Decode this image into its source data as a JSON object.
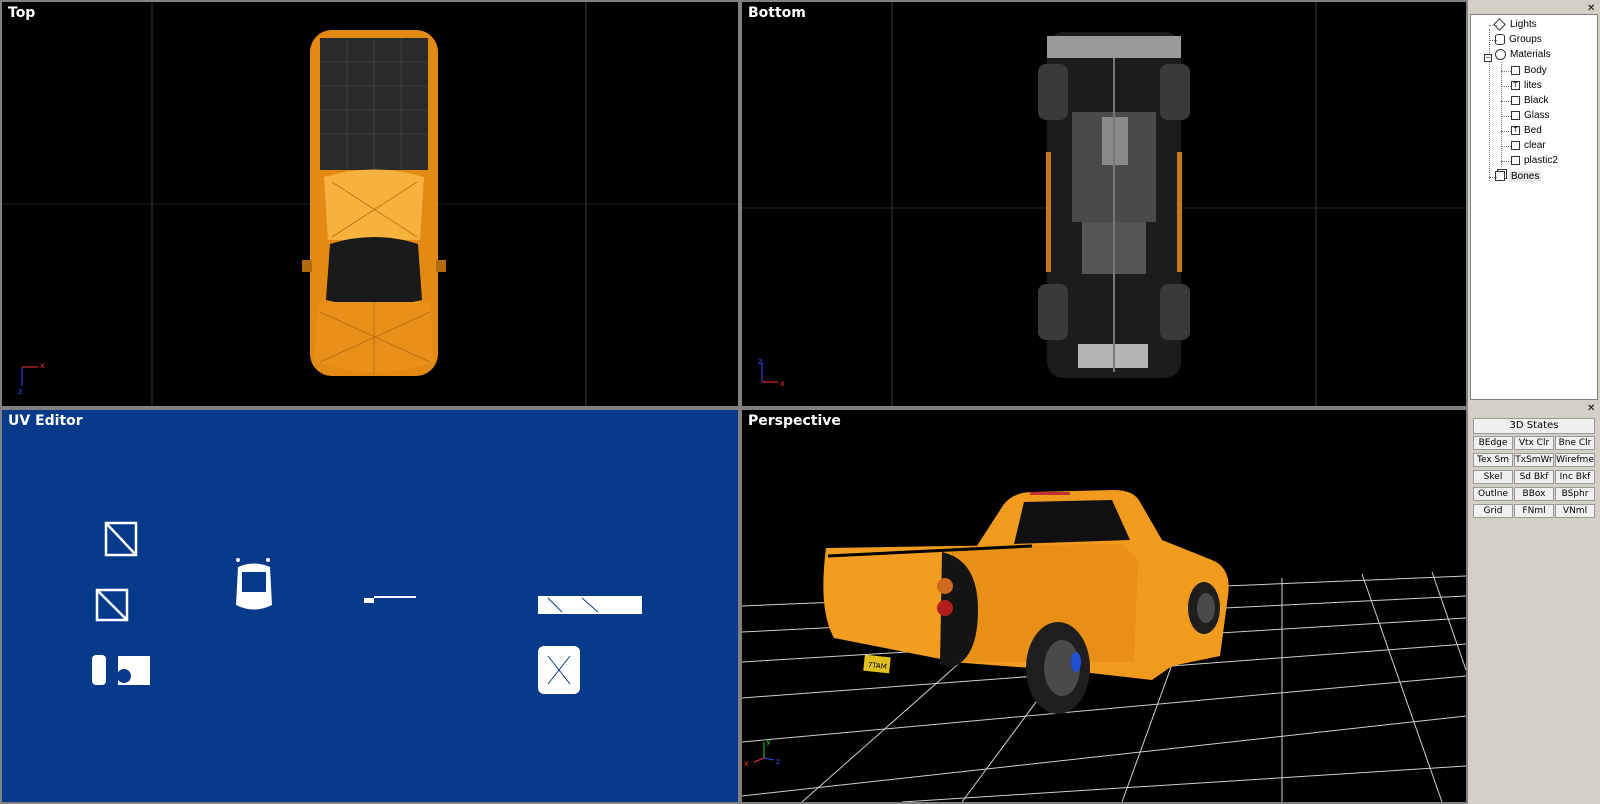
{
  "viewports": {
    "top": {
      "title": "Top"
    },
    "bottom": {
      "title": "Bottom"
    },
    "uv": {
      "title": "UV Editor"
    },
    "perspective": {
      "title": "Perspective"
    }
  },
  "scene_tree": {
    "items": [
      {
        "label": "Lights",
        "icon": "light-icon"
      },
      {
        "label": "Groups",
        "icon": "group-icon"
      },
      {
        "label": "Materials",
        "icon": "material-icon"
      },
      {
        "label": "Body",
        "icon": "material-item-icon"
      },
      {
        "label": "lites",
        "icon": "texture-item-icon"
      },
      {
        "label": "Black",
        "icon": "material-item-icon"
      },
      {
        "label": "Glass",
        "icon": "material-item-icon"
      },
      {
        "label": "Bed",
        "icon": "texture-item-icon"
      },
      {
        "label": "clear",
        "icon": "material-item-icon"
      },
      {
        "label": "plastic2",
        "icon": "material-item-icon"
      },
      {
        "label": "Bones",
        "icon": "bones-icon"
      }
    ]
  },
  "states_panel": {
    "header": "3D States",
    "buttons": [
      "BEdge",
      "Vtx Clr",
      "Bne Clr",
      "Tex Sm",
      "TxSmWr",
      "Wirefme",
      "Skel",
      "Sd Bkf",
      "Inc Bkf",
      "Outlne",
      "BBox",
      "BSphr",
      "Grid",
      "FNml",
      "VNml"
    ]
  },
  "colors": {
    "body_orange": "#f09a1e",
    "uv_background": "#053a8a",
    "viewport_background": "#000000"
  },
  "axes": {
    "x": "x",
    "y": "y",
    "z": "z"
  },
  "license_plate": "7TAM"
}
